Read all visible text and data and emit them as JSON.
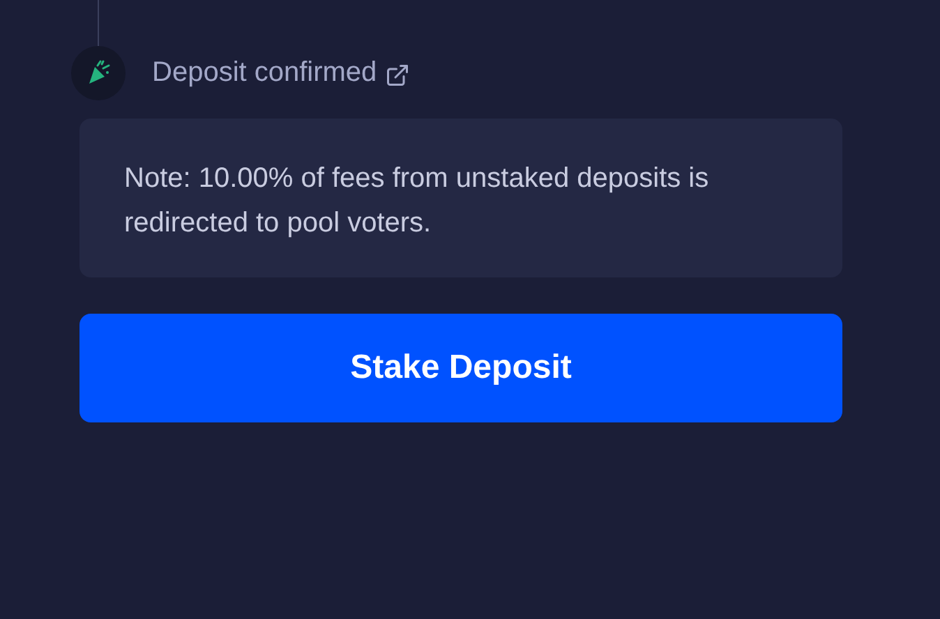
{
  "step": {
    "label": "Deposit confirmed"
  },
  "note": "Note: 10.00% of fees from unstaked deposits is redirected to pool voters.",
  "button": "Stake Deposit"
}
